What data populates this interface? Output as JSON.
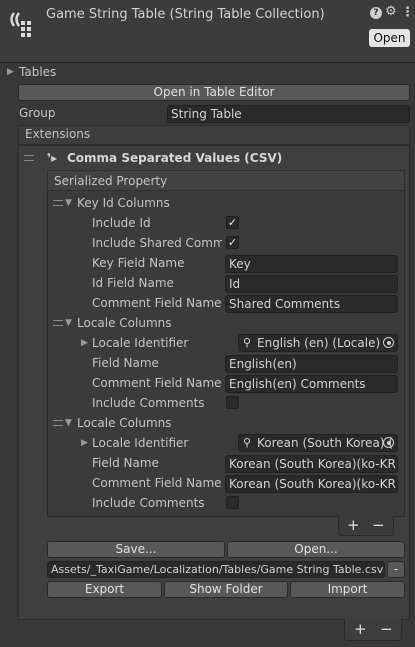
{
  "header": {
    "title": "Game String Table (String Table Collection)",
    "open_label": "Open",
    "help_icon": "?",
    "settings_icon": "⚙",
    "menu_icon": "⋮"
  },
  "tables_label": "Tables",
  "open_table_editor_label": "Open in Table Editor",
  "group": {
    "label": "Group",
    "value": "String Table"
  },
  "extensions_label": "Extensions",
  "csv": {
    "title": "Comma Separated Values (CSV)",
    "serialized_property": "Serialized Property",
    "key_id": {
      "header": "Key Id Columns",
      "include_id_label": "Include Id",
      "include_shared_label": "Include Shared Comme",
      "key_field_label": "Key Field Name",
      "key_field_value": "Key",
      "id_field_label": "Id Field Name",
      "id_field_value": "Id",
      "comment_field_label": "Comment Field Name",
      "comment_field_value": "Shared Comments"
    },
    "locale1": {
      "header": "Locale Columns",
      "locale_label": "Locale Identifier",
      "locale_value": "English (en) (Locale)",
      "field_label": "Field Name",
      "field_value": "English(en)",
      "comment_label": "Comment Field Name",
      "comment_value": "English(en) Comments",
      "include_comments_label": "Include Comments"
    },
    "locale2": {
      "header": "Locale Columns",
      "locale_label": "Locale Identifier",
      "locale_value": "Korean (South Korea) (",
      "field_label": "Field Name",
      "field_value": "Korean (South Korea)(ko-KR)",
      "comment_label": "Comment Field Name",
      "comment_value": "Korean (South Korea)(ko-KR)",
      "include_comments_label": "Include Comments"
    },
    "plus": "+",
    "minus": "−",
    "save_label": "Save...",
    "open_label": "Open...",
    "path": "Assets/_TaxiGame/Localization/Tables/Game String Table.csv",
    "path_minus": "-",
    "export_label": "Export",
    "show_folder_label": "Show Folder",
    "import_label": "Import"
  },
  "footer": {
    "plus": "+",
    "minus": "−"
  }
}
